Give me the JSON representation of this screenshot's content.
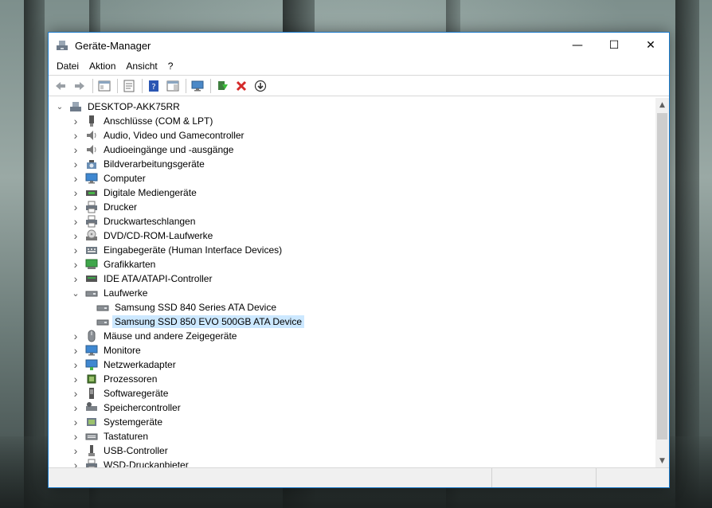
{
  "window": {
    "title": "Geräte-Manager",
    "controls": {
      "minimize": "—",
      "maximize": "☐",
      "close": "✕"
    }
  },
  "menubar": {
    "items": [
      "Datei",
      "Aktion",
      "Ansicht",
      "?"
    ]
  },
  "toolbar": {
    "icons": [
      "back-arrow-icon",
      "forward-arrow-icon",
      "show-hide-console-tree-icon",
      "properties-icon",
      "help-icon",
      "action-pane-icon",
      "scan-hardware-icon",
      "update-driver-icon",
      "uninstall-device-icon",
      "disable-device-icon"
    ]
  },
  "tree": {
    "root": "DESKTOP-AKK75RR",
    "categories": [
      {
        "label": "Anschlüsse (COM & LPT)",
        "icon": "port-icon",
        "expanded": false
      },
      {
        "label": "Audio, Video und Gamecontroller",
        "icon": "speaker-icon",
        "expanded": false
      },
      {
        "label": "Audioeingänge und -ausgänge",
        "icon": "speaker-icon",
        "expanded": false
      },
      {
        "label": "Bildverarbeitungsgeräte",
        "icon": "camera-icon",
        "expanded": false
      },
      {
        "label": "Computer",
        "icon": "monitor-icon",
        "expanded": false
      },
      {
        "label": "Digitale Mediengeräte",
        "icon": "media-device-icon",
        "expanded": false
      },
      {
        "label": "Drucker",
        "icon": "printer-icon",
        "expanded": false
      },
      {
        "label": "Druckwarteschlangen",
        "icon": "printer-icon",
        "expanded": false
      },
      {
        "label": "DVD/CD-ROM-Laufwerke",
        "icon": "disc-drive-icon",
        "expanded": false
      },
      {
        "label": "Eingabegeräte (Human Interface Devices)",
        "icon": "hid-icon",
        "expanded": false
      },
      {
        "label": "Grafikkarten",
        "icon": "display-adapter-icon",
        "expanded": false
      },
      {
        "label": "IDE ATA/ATAPI-Controller",
        "icon": "controller-icon",
        "expanded": false
      },
      {
        "label": "Laufwerke",
        "icon": "drive-icon",
        "expanded": true,
        "children": [
          {
            "label": "Samsung SSD 840 Series ATA Device",
            "icon": "drive-icon",
            "selected": false
          },
          {
            "label": "Samsung SSD 850 EVO 500GB ATA Device",
            "icon": "drive-icon",
            "selected": true
          }
        ]
      },
      {
        "label": "Mäuse und andere Zeigegeräte",
        "icon": "mouse-icon",
        "expanded": false
      },
      {
        "label": "Monitore",
        "icon": "monitor-icon",
        "expanded": false
      },
      {
        "label": "Netzwerkadapter",
        "icon": "network-icon",
        "expanded": false
      },
      {
        "label": "Prozessoren",
        "icon": "cpu-icon",
        "expanded": false
      },
      {
        "label": "Softwaregeräte",
        "icon": "software-device-icon",
        "expanded": false
      },
      {
        "label": "Speichercontroller",
        "icon": "storage-controller-icon",
        "expanded": false
      },
      {
        "label": "Systemgeräte",
        "icon": "system-device-icon",
        "expanded": false
      },
      {
        "label": "Tastaturen",
        "icon": "keyboard-icon",
        "expanded": false
      },
      {
        "label": "USB-Controller",
        "icon": "usb-icon",
        "expanded": false
      },
      {
        "label": "WSD-Druckanbieter",
        "icon": "printer-icon",
        "expanded": false
      }
    ]
  },
  "colors": {
    "accent": "#1979ca",
    "selection": "#cce8ff"
  }
}
